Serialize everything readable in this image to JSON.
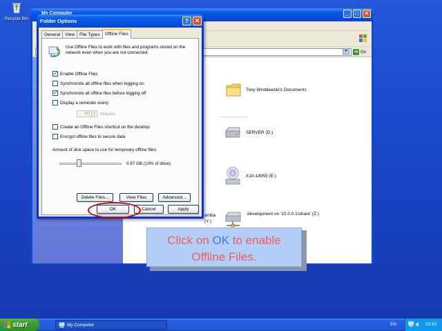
{
  "desktop": {
    "recycle_bin_label": "Recycle Bin"
  },
  "my_computer": {
    "title": "My Computer",
    "address_go_label": "Go",
    "items": [
      {
        "icon": "folder-icon",
        "label": "Tony Wroblewski's Documents"
      },
      {
        "icon": "hard-drive-icon",
        "label": "SERVER (D:)"
      },
      {
        "icon": "cd-drive-icon",
        "label": "X10-14955 (E:)"
      },
      {
        "icon": "network-drive-icon",
        "label": "development on '10.0.0.1\\share' (Z:)"
      }
    ],
    "partial_texts": {
      "ge": "ge",
      "samba_line1": "amba",
      "samba_line2": "(Y:)"
    }
  },
  "dialog": {
    "title": "Folder Options",
    "help_label": "?",
    "close_label": "✕",
    "tabs": [
      {
        "label": "General",
        "active": false
      },
      {
        "label": "View",
        "active": false
      },
      {
        "label": "File Types",
        "active": false
      },
      {
        "label": "Offline Files",
        "active": true
      }
    ],
    "intro_text": "Use Offline Files to work with files and programs stored on the network even when you are not connected.",
    "options": [
      {
        "label": "Enable Offline Files",
        "checked": true
      },
      {
        "label": "Synchronize all offline files when logging on",
        "checked": false
      },
      {
        "label": "Synchronize all offline files before logging off",
        "checked": true
      },
      {
        "label": "Display a reminder every:",
        "checked": false
      },
      {
        "label": "Create an Offline Files shortcut on the desktop",
        "checked": false
      },
      {
        "label": "Encrypt offline files to secure data",
        "checked": false
      }
    ],
    "reminder_value": "60",
    "reminder_unit": "minutes.",
    "disk_space_label": "Amount of disk space to use for temporary offline files:",
    "disk_space_value": "0.97 GB (10% of drive)",
    "disk_space_fraction": 0.3,
    "buttons": {
      "delete_files": "Delete Files...",
      "view_files": "View Files",
      "advanced": "Advanced...",
      "ok": "OK",
      "cancel": "Cancel",
      "apply": "Apply"
    }
  },
  "callout": {
    "pre": "Click on ",
    "highlight": "OK",
    "post": " to enable",
    "line2": "Offline Files."
  },
  "taskbar": {
    "start_label": "start",
    "task_label": "My Computer",
    "language": "EN",
    "clock": "10:10"
  },
  "colors": {
    "desktop_blue": "#1a45c7",
    "callout_bg": "#b4cff7",
    "callout_text": "#ef5b5b",
    "callout_highlight": "#4f72e6",
    "emphasis_ring": "#d40000"
  }
}
